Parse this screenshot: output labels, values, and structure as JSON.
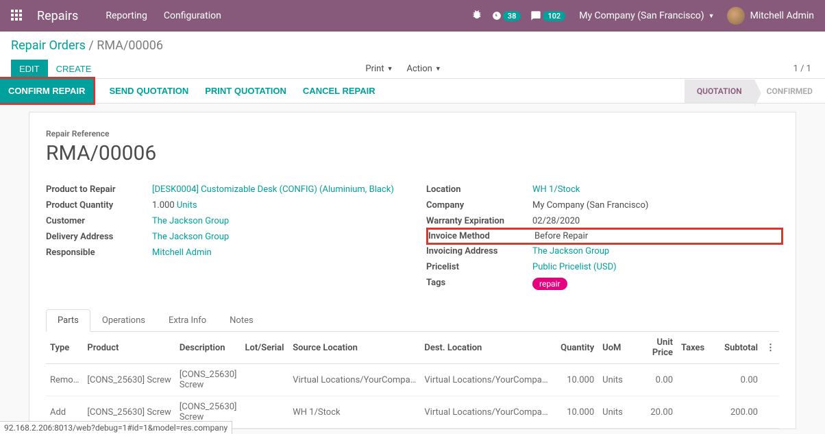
{
  "topbar": {
    "app_title": "Repairs",
    "nav": [
      "Reporting",
      "Configuration"
    ],
    "badge1": "38",
    "badge2": "102",
    "company": "My Company (San Francisco)",
    "user": "Mitchell Admin"
  },
  "breadcrumb": {
    "root": "Repair Orders",
    "current": "RMA/00006"
  },
  "buttons": {
    "edit": "EDIT",
    "create": "CREATE",
    "print": "Print",
    "action": "Action"
  },
  "pager": "1 / 1",
  "status_buttons": {
    "confirm": "CONFIRM REPAIR",
    "send": "SEND QUOTATION",
    "print": "PRINT QUOTATION",
    "cancel": "CANCEL REPAIR"
  },
  "stages": {
    "quotation": "QUOTATION",
    "confirmed": "CONFIRMED"
  },
  "reference": {
    "label": "Repair Reference",
    "value": "RMA/00006"
  },
  "left_fields": {
    "product_to_repair": {
      "label": "Product to Repair",
      "value": "[DESK0004] Customizable Desk (CONFIG) (Aluminium, Black)"
    },
    "product_quantity": {
      "label": "Product Quantity",
      "value": "1.000",
      "uom": "Units"
    },
    "customer": {
      "label": "Customer",
      "value": "The Jackson Group"
    },
    "delivery_address": {
      "label": "Delivery Address",
      "value": "The Jackson Group"
    },
    "responsible": {
      "label": "Responsible",
      "value": "Mitchell Admin"
    }
  },
  "right_fields": {
    "location": {
      "label": "Location",
      "value": "WH 1/Stock"
    },
    "company": {
      "label": "Company",
      "value": "My Company (San Francisco)"
    },
    "warranty": {
      "label": "Warranty Expiration",
      "value": "02/28/2020"
    },
    "invoice_method": {
      "label": "Invoice Method",
      "value": "Before Repair"
    },
    "invoicing_address": {
      "label": "Invoicing Address",
      "value": "The Jackson Group"
    },
    "pricelist": {
      "label": "Pricelist",
      "value": "Public Pricelist (USD)"
    },
    "tags": {
      "label": "Tags",
      "value": "repair"
    }
  },
  "tabs": {
    "parts": "Parts",
    "operations": "Operations",
    "extra": "Extra Info",
    "notes": "Notes"
  },
  "parts_headers": {
    "type": "Type",
    "product": "Product",
    "description": "Description",
    "lot": "Lot/Serial",
    "source": "Source Location",
    "dest": "Dest. Location",
    "qty": "Quantity",
    "uom": "UoM",
    "price": "Unit Price",
    "taxes": "Taxes",
    "subtotal": "Subtotal"
  },
  "parts_rows": [
    {
      "type": "Remo…",
      "product": "[CONS_25630] Screw",
      "description": "[CONS_25630] Screw",
      "lot": "",
      "source": "Virtual Locations/YourCompa…",
      "dest": "Virtual Locations/YourCompa…",
      "qty": "10.000",
      "uom": "Units",
      "price": "0.00",
      "taxes": "",
      "subtotal": "0.00"
    },
    {
      "type": "Add",
      "product": "[CONS_25630] Screw",
      "description": "[CONS_25630] Screw",
      "lot": "",
      "source": "WH 1/Stock",
      "dest": "Virtual Locations/YourCompa…",
      "qty": "10.000",
      "uom": "Units",
      "price": "20.00",
      "taxes": "",
      "subtotal": "200.00"
    }
  ],
  "statusbar": "92.168.2.206:8013/web?debug=1#id=1&model=res.company"
}
